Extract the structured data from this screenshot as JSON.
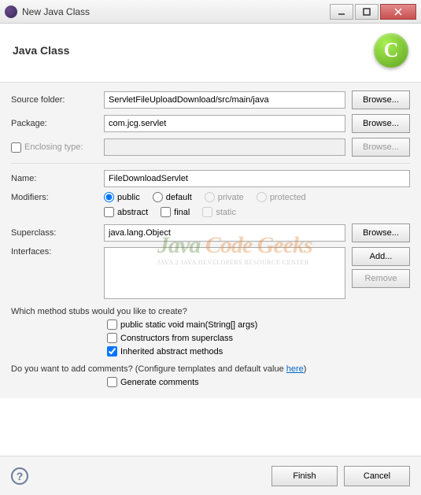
{
  "titlebar": {
    "title": "New Java Class"
  },
  "header": {
    "title": "Java Class",
    "icon_letter": "C"
  },
  "fields": {
    "source_folder": {
      "label": "Source folder:",
      "value": "ServletFileUploadDownload/src/main/java",
      "browse": "Browse..."
    },
    "package": {
      "label": "Package:",
      "value": "com.jcg.servlet",
      "browse": "Browse..."
    },
    "enclosing": {
      "label": "Enclosing type:",
      "value": "",
      "browse": "Browse..."
    },
    "name": {
      "label": "Name:",
      "value": "FileDownloadServlet"
    },
    "modifiers": {
      "label": "Modifiers:",
      "access": {
        "public": "public",
        "default": "default",
        "private": "private",
        "protected": "protected"
      },
      "other": {
        "abstract": "abstract",
        "final": "final",
        "static": "static"
      }
    },
    "superclass": {
      "label": "Superclass:",
      "value": "java.lang.Object",
      "browse": "Browse..."
    },
    "interfaces": {
      "label": "Interfaces:",
      "add": "Add...",
      "remove": "Remove"
    }
  },
  "stubs": {
    "question": "Which method stubs would you like to create?",
    "main": "public static void main(String[] args)",
    "constructors": "Constructors from superclass",
    "inherited": "Inherited abstract methods"
  },
  "comments": {
    "question_pre": "Do you want to add comments? (Configure templates and default value ",
    "link": "here",
    "question_post": ")",
    "generate": "Generate comments"
  },
  "footer": {
    "finish": "Finish",
    "cancel": "Cancel"
  },
  "watermark": {
    "line1a": "Java ",
    "line1b": "Code Geeks",
    "line2": "JAVA 2 JAVA DEVELOPERS RESOURCE CENTER"
  }
}
